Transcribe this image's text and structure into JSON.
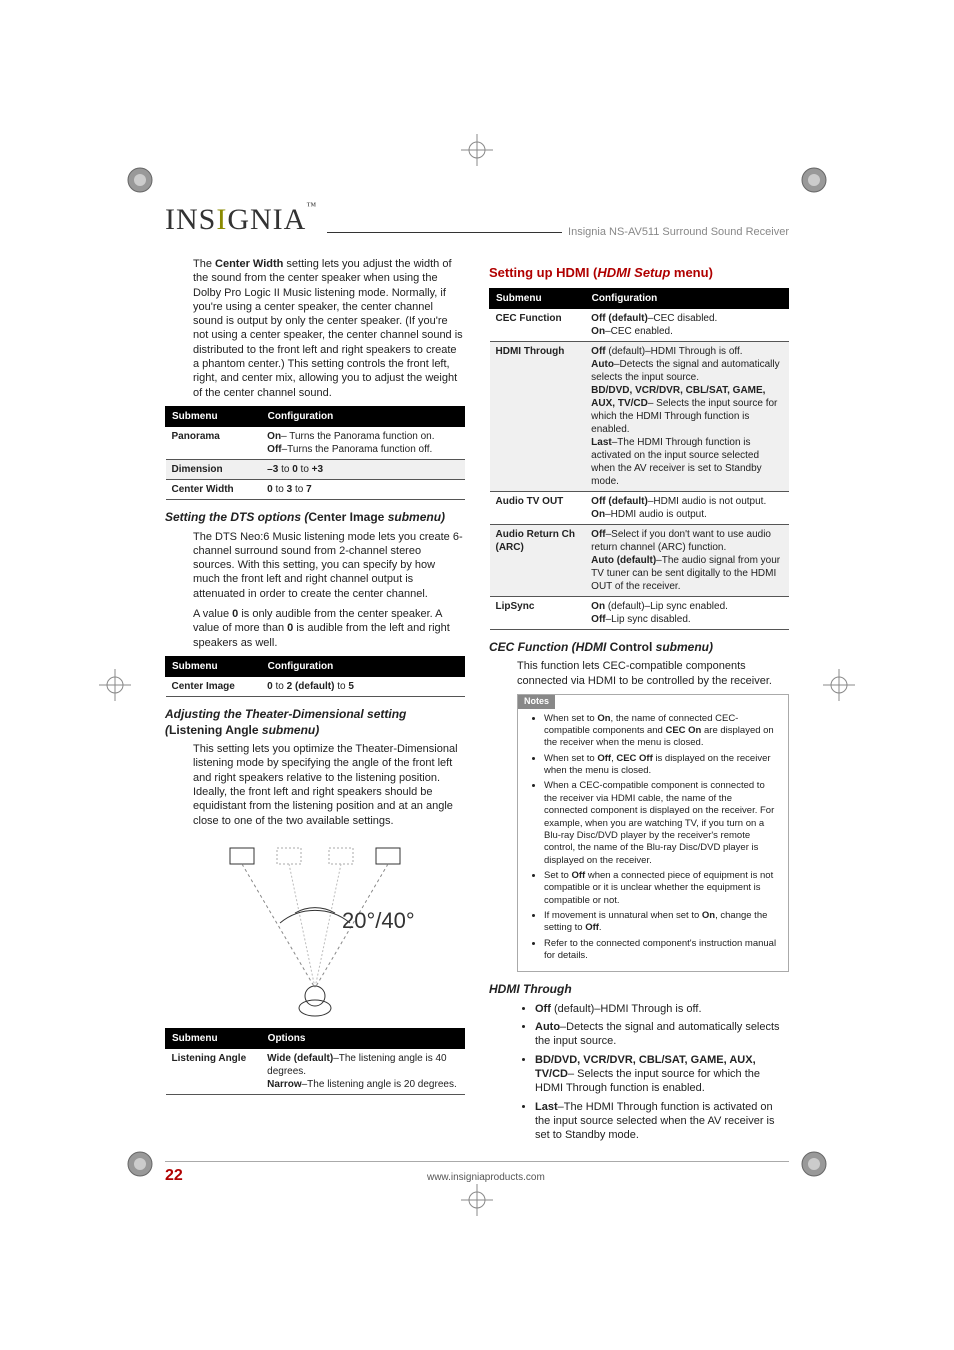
{
  "doc_title": "Insignia NS-AV511 Surround Sound Receiver",
  "logo": "INSIGNIA",
  "page_number": "22",
  "footer_url": "www.insigniaproducts.com",
  "left": {
    "intro": "The Center Width setting lets you adjust the width of the sound from the center speaker when using the Dolby Pro Logic II Music listening mode. Normally, if you're using a center speaker, the center channel sound is output by only the center speaker. (If you're not using a center speaker, the center channel sound is distributed to the front left and right speakers to create a phantom center.) This setting controls the front left, right, and center mix, allowing you to adjust the weight of the center channel sound.",
    "table1": {
      "h1": "Submenu",
      "h2": "Configuration",
      "rows": [
        {
          "k": "Panorama",
          "v": [
            {
              "b": "On",
              "t": "– Turns the Panorama function on."
            },
            {
              "b": "Off",
              "t": "–Turns the Panorama function off."
            }
          ]
        },
        {
          "k": "Dimension",
          "v": [
            {
              "b": "–3",
              "t": " to "
            },
            {
              "b": "0",
              "t": " to "
            },
            {
              "b": "+3",
              "t": ""
            }
          ],
          "inline": true
        },
        {
          "k": "Center Width",
          "v": [
            {
              "b": "0",
              "t": " to "
            },
            {
              "b": "3",
              "t": " to "
            },
            {
              "b": "7",
              "t": ""
            }
          ],
          "inline": true
        }
      ]
    },
    "h_dts": {
      "pre": "Setting the DTS options (",
      "mid": "Center Image",
      "post": " submenu)"
    },
    "dts_p1": "The DTS Neo:6 Music listening mode lets you create 6-channel surround sound from 2-channel stereo sources. With this setting, you can specify by how much the front left and right channel output is attenuated in order to create the center channel.",
    "dts_p2": "A value 0 is only audible from the center speaker. A value of more than 0 is audible from the left and right speakers as well.",
    "table2": {
      "h1": "Submenu",
      "h2": "Configuration",
      "rows": [
        {
          "k": "Center Image",
          "v": [
            {
              "b": "0",
              "t": " to "
            },
            {
              "b": "2 (default)",
              "t": " to "
            },
            {
              "b": "5",
              "t": ""
            }
          ],
          "inline": true
        }
      ]
    },
    "h_thd": {
      "pre": "Adjusting the Theater-Dimensional setting (",
      "mid": "Listening Angle",
      "post": " submenu)"
    },
    "thd_p": "This setting lets you optimize the Theater-Dimensional listening mode by specifying the angle of the front left and right speakers relative to the listening position. Ideally, the front left and right speakers should be equidistant from the listening position and at an angle close to one of the two available settings.",
    "diagram_label": "20°/40°",
    "table3": {
      "h1": "Submenu",
      "h2": "Options",
      "rows": [
        {
          "k": "Listening Angle",
          "v": [
            {
              "b": "Wide (default)",
              "t": "–The listening angle is 40 degrees."
            },
            {
              "b": "Narrow",
              "t": "–The listening angle is 20 degrees."
            }
          ]
        }
      ]
    }
  },
  "right": {
    "h_hdmi": {
      "pre": "Setting up HDMI (",
      "mid": "HDMI Setup",
      "post": " menu)"
    },
    "table4": {
      "h1": "Submenu",
      "h2": "Configuration",
      "rows": [
        {
          "k": "CEC Function",
          "v": [
            {
              "b": "Off (default)",
              "t": "–CEC disabled."
            },
            {
              "b": "On",
              "t": "–CEC enabled."
            }
          ]
        },
        {
          "k": "HDMI Through",
          "v": [
            {
              "b": "Off",
              "t": " (default)–HDMI Through is off."
            },
            {
              "b": "Auto",
              "t": "–Detects the signal and automatically selects the input source."
            },
            {
              "b": "BD/DVD, VCR/DVR, CBL/SAT, GAME, AUX, TV/CD",
              "t": "– Selects the input source for which the HDMI Through function is enabled."
            },
            {
              "b": "Last",
              "t": "–The HDMI Through function is activated on the input source selected when the AV receiver is set to Standby mode."
            }
          ]
        },
        {
          "k": "Audio TV OUT",
          "v": [
            {
              "b": "Off (default)",
              "t": "–HDMI audio is not output."
            },
            {
              "b": "On",
              "t": "–HDMI audio is output."
            }
          ]
        },
        {
          "k": "Audio Return Ch (ARC)",
          "v": [
            {
              "b": "Off",
              "t": "–Select if you don't want to use audio return channel (ARC) function."
            },
            {
              "b": "Auto (default)",
              "t": "–The audio signal from your TV tuner can be sent digitally to the HDMI OUT of the receiver."
            }
          ]
        },
        {
          "k": "LipSync",
          "v": [
            {
              "b": "On",
              "t": " (default)–Lip sync enabled."
            },
            {
              "b": "Off",
              "t": "–Lip sync disabled."
            }
          ]
        }
      ]
    },
    "h_cec": {
      "pre": "CEC Function (HDMI ",
      "mid": "Control",
      "post": " submenu)"
    },
    "cec_p": "This function lets CEC-compatible components connected via HDMI to be controlled by the receiver.",
    "notes_label": "Notes",
    "notes": [
      "When set to <b>On</b>, the name of connected CEC-compatible components and <b>CEC On</b> are displayed on the receiver when the menu is closed.",
      "When set to <b>Off</b>, <b>CEC Off</b> is displayed on the receiver when the menu is closed.",
      "When a CEC-compatible component is connected to the receiver via HDMI cable, the name of the connected component is displayed on the receiver. For example, when you are watching TV, if you turn on a Blu-ray Disc/DVD player by the receiver's remote control, the name of the Blu-ray Disc/DVD player is displayed on the receiver.",
      "Set to <b>Off</b> when a connected piece of equipment is not compatible or it is unclear whether the equipment is compatible or not.",
      "If movement is unnatural when set to <b>On</b>, change the setting to <b>Off</b>.",
      "Refer to the connected component's instruction manual for details."
    ],
    "h_through": "HDMI Through",
    "through_bullets": [
      "<b>Off</b> (default)–HDMI Through is off.",
      "<b>Auto</b>–Detects the signal and automatically selects the input source.",
      "<b>BD/DVD, VCR/DVR, CBL/SAT, GAME, AUX, TV/CD</b>– Selects the input source for which the HDMI Through function is enabled.",
      "<b>Last</b>–The HDMI Through function is activated on the input source selected when the AV receiver is set to Standby mode."
    ]
  }
}
